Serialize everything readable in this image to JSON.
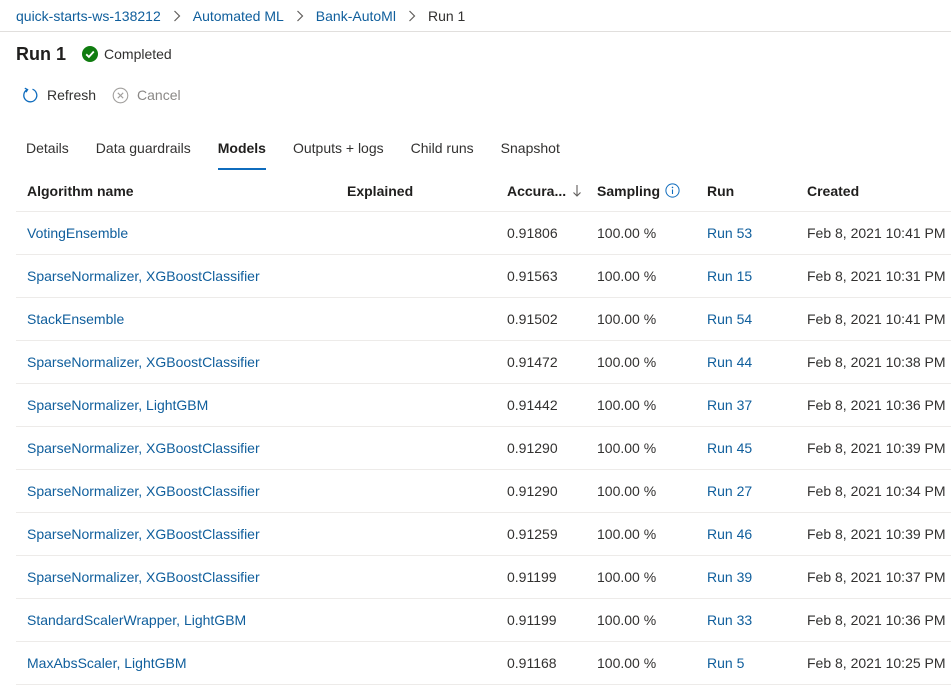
{
  "breadcrumb": {
    "items": [
      "quick-starts-ws-138212",
      "Automated ML",
      "Bank-AutoMl"
    ],
    "current": "Run 1"
  },
  "header": {
    "title": "Run 1",
    "status": "Completed",
    "status_color": "#107c10"
  },
  "toolbar": {
    "refresh_label": "Refresh",
    "cancel_label": "Cancel"
  },
  "tabs": [
    {
      "label": "Details",
      "active": false
    },
    {
      "label": "Data guardrails",
      "active": false
    },
    {
      "label": "Models",
      "active": true
    },
    {
      "label": "Outputs + logs",
      "active": false
    },
    {
      "label": "Child runs",
      "active": false
    },
    {
      "label": "Snapshot",
      "active": false
    }
  ],
  "table": {
    "columns": {
      "algorithm": "Algorithm name",
      "explained": "Explained",
      "accuracy": "Accura...",
      "sampling": "Sampling",
      "run": "Run",
      "created": "Created"
    },
    "rows": [
      {
        "algorithm": "VotingEnsemble",
        "explained": "",
        "accuracy": "0.91806",
        "sampling": "100.00 %",
        "run": "Run 53",
        "created": "Feb 8, 2021 10:41 PM"
      },
      {
        "algorithm": "SparseNormalizer, XGBoostClassifier",
        "explained": "",
        "accuracy": "0.91563",
        "sampling": "100.00 %",
        "run": "Run 15",
        "created": "Feb 8, 2021 10:31 PM"
      },
      {
        "algorithm": "StackEnsemble",
        "explained": "",
        "accuracy": "0.91502",
        "sampling": "100.00 %",
        "run": "Run 54",
        "created": "Feb 8, 2021 10:41 PM"
      },
      {
        "algorithm": "SparseNormalizer, XGBoostClassifier",
        "explained": "",
        "accuracy": "0.91472",
        "sampling": "100.00 %",
        "run": "Run 44",
        "created": "Feb 8, 2021 10:38 PM"
      },
      {
        "algorithm": "SparseNormalizer, LightGBM",
        "explained": "",
        "accuracy": "0.91442",
        "sampling": "100.00 %",
        "run": "Run 37",
        "created": "Feb 8, 2021 10:36 PM"
      },
      {
        "algorithm": "SparseNormalizer, XGBoostClassifier",
        "explained": "",
        "accuracy": "0.91290",
        "sampling": "100.00 %",
        "run": "Run 45",
        "created": "Feb 8, 2021 10:39 PM"
      },
      {
        "algorithm": "SparseNormalizer, XGBoostClassifier",
        "explained": "",
        "accuracy": "0.91290",
        "sampling": "100.00 %",
        "run": "Run 27",
        "created": "Feb 8, 2021 10:34 PM"
      },
      {
        "algorithm": "SparseNormalizer, XGBoostClassifier",
        "explained": "",
        "accuracy": "0.91259",
        "sampling": "100.00 %",
        "run": "Run 46",
        "created": "Feb 8, 2021 10:39 PM"
      },
      {
        "algorithm": "SparseNormalizer, XGBoostClassifier",
        "explained": "",
        "accuracy": "0.91199",
        "sampling": "100.00 %",
        "run": "Run 39",
        "created": "Feb 8, 2021 10:37 PM"
      },
      {
        "algorithm": "StandardScalerWrapper, LightGBM",
        "explained": "",
        "accuracy": "0.91199",
        "sampling": "100.00 %",
        "run": "Run 33",
        "created": "Feb 8, 2021 10:36 PM"
      },
      {
        "algorithm": "MaxAbsScaler, LightGBM",
        "explained": "",
        "accuracy": "0.91168",
        "sampling": "100.00 %",
        "run": "Run 5",
        "created": "Feb 8, 2021 10:25 PM"
      }
    ]
  },
  "colors": {
    "link": "#0f5e9c",
    "accent": "#0f6cbd",
    "success": "#107c10"
  }
}
